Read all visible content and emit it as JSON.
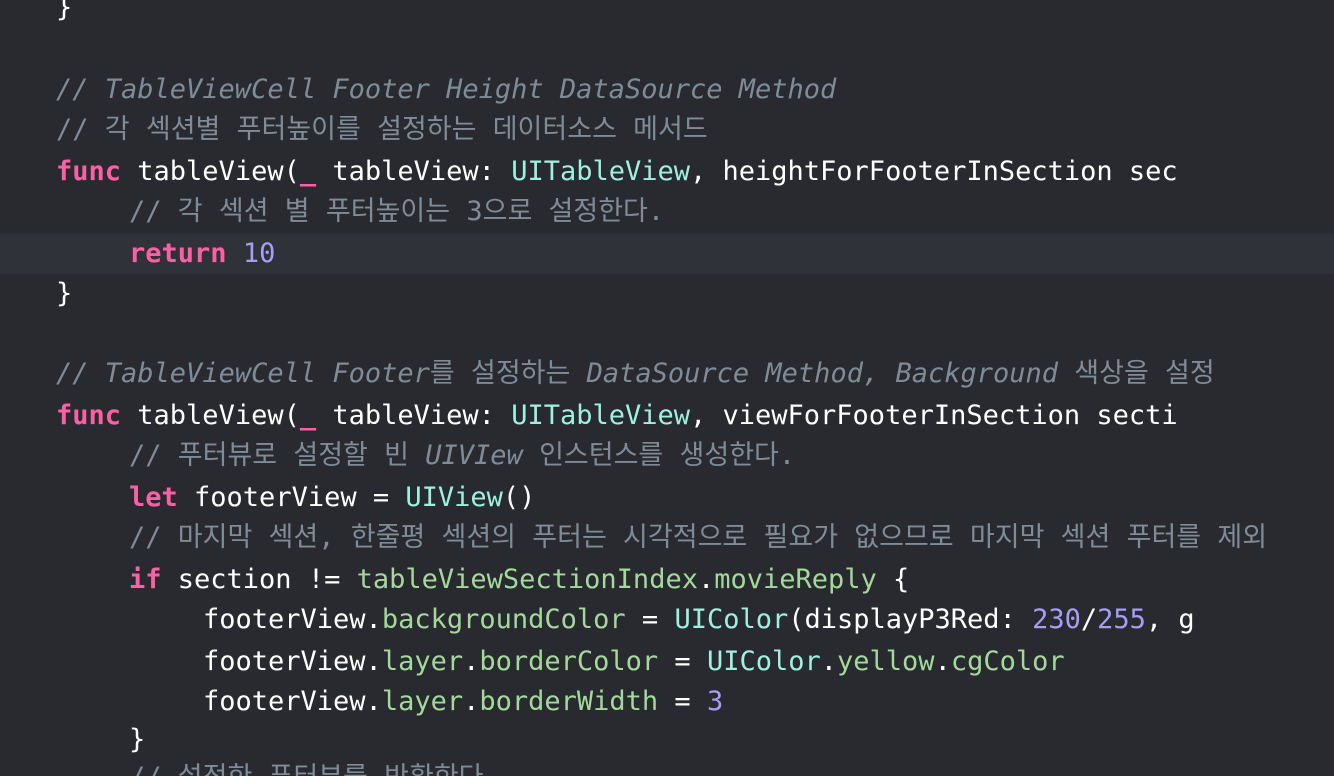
{
  "lines": [
    {
      "tokens": [
        "}"
      ]
    },
    {
      "tokens": []
    },
    {
      "tokens": [
        "// TableViewCell Footer Height DataSource Method"
      ]
    },
    {
      "tokens": [
        "// 각 섹션별 푸터높이를 설정하는 데이터소스 메서드"
      ]
    },
    {
      "tokens": [
        "func",
        " tableView(",
        "_",
        " tableView: ",
        "UITableView",
        ", heightForFooterInSection sec"
      ]
    },
    {
      "tokens": [
        "// 각 섹션 별 푸터높이는 3으로 설정한다."
      ]
    },
    {
      "tokens": [
        "return",
        " ",
        "10"
      ]
    },
    {
      "tokens": [
        "}"
      ]
    },
    {
      "tokens": []
    },
    {
      "tokens": [
        "// ",
        "TableViewCell Footer",
        "를 설정하는 ",
        "DataSource Method, Background",
        " 색상을 설정"
      ]
    },
    {
      "tokens": [
        "func",
        " tableView(",
        "_",
        " tableView: ",
        "UITableView",
        ", viewForFooterInSection secti"
      ]
    },
    {
      "tokens": [
        "// 푸터뷰로 설정할 빈 ",
        "UIVIew",
        " 인스턴스를 생성한다."
      ]
    },
    {
      "tokens": [
        "let",
        " footerView = ",
        "UIView",
        "()"
      ]
    },
    {
      "tokens": [
        "// 마지막 섹션, 한줄평 섹션의 푸터는 시각적으로 필요가 없으므로 마지막 섹션 푸터를 제외"
      ]
    },
    {
      "tokens": [
        "if",
        " section != ",
        "tableViewSectionIndex",
        ".",
        "movieReply",
        " {"
      ]
    },
    {
      "tokens": [
        "footerView.",
        "backgroundColor",
        " = ",
        "UIColor",
        "(displayP3Red: ",
        "230",
        "/",
        "255",
        ", g"
      ]
    },
    {
      "tokens": [
        "footerView.",
        "layer",
        ".",
        "borderColor",
        " = ",
        "UIColor",
        ".",
        "yellow",
        ".",
        "cgColor"
      ]
    },
    {
      "tokens": [
        "footerView.",
        "layer",
        ".",
        "borderWidth",
        " = ",
        "3"
      ]
    },
    {
      "tokens": [
        "}"
      ]
    },
    {
      "tokens": [
        "// 설정한 푸터뷰를 반환한다."
      ]
    }
  ],
  "colors": {
    "background": "#292a30",
    "current_line": "#2f3239",
    "keyword": "#fc5fa3",
    "comment": "#7f8c98",
    "type": "#9ef1dd",
    "property": "#a3d99b",
    "number": "#a79df5",
    "plain": "#ffffff"
  }
}
